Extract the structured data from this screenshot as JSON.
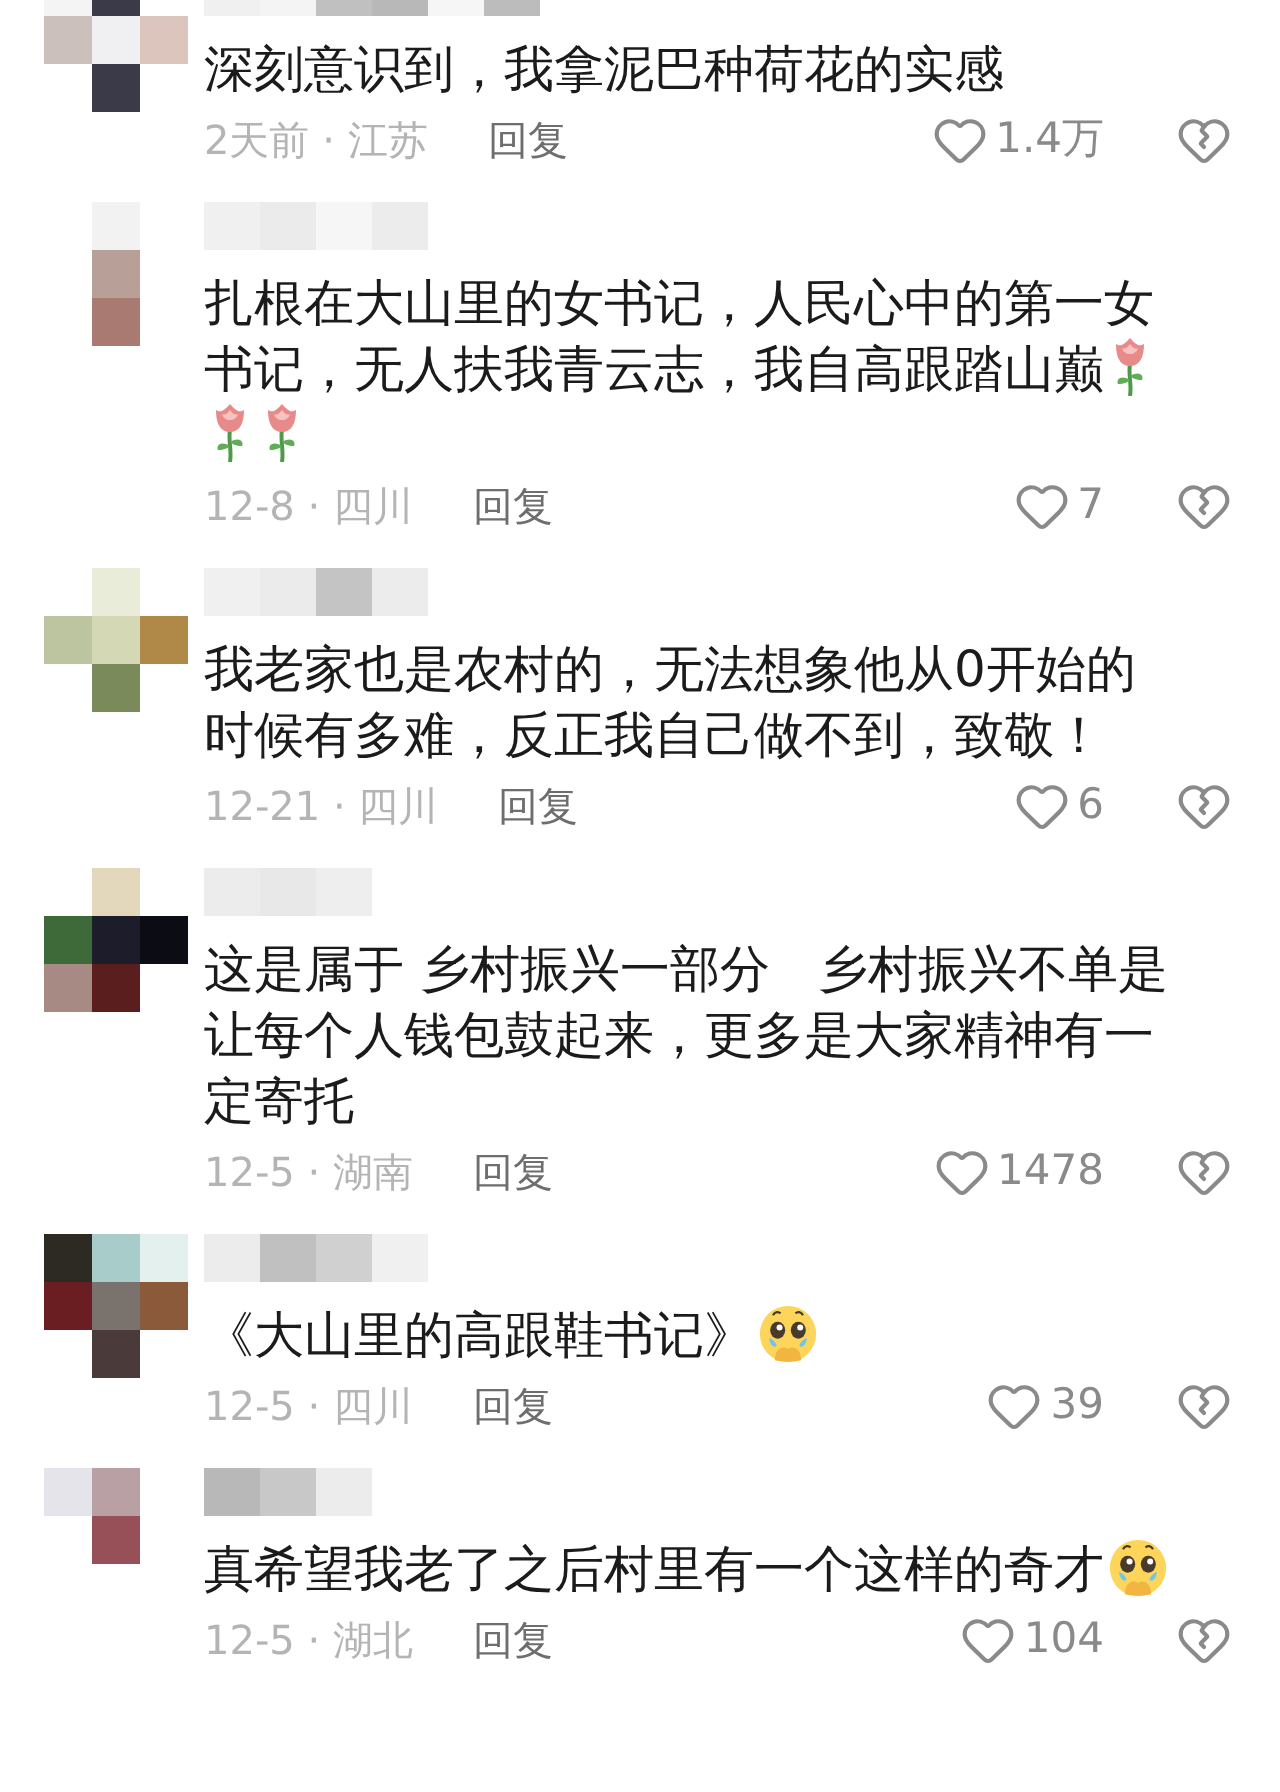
{
  "comments": [
    {
      "body": [
        {
          "kind": "text",
          "text": "深刻意识到，我拿泥巴种荷花的实感"
        }
      ],
      "time": "2天前 · 江苏",
      "reply": "回复",
      "likes": "1.4万"
    },
    {
      "body": [
        {
          "kind": "text",
          "text": "扎根在大山里的女书记，人民心中的第一女书记，无人扶我青云志，我自高跟踏山巅"
        },
        {
          "kind": "rose"
        },
        {
          "kind": "rose"
        },
        {
          "kind": "rose"
        }
      ],
      "time": "12-8 · 四川",
      "reply": "回复",
      "likes": "7"
    },
    {
      "body": [
        {
          "kind": "text",
          "text": "我老家也是农村的，无法想象他从0开始的时候有多难，反正我自己做不到，致敬！"
        }
      ],
      "time": "12-21 · 四川",
      "reply": "回复",
      "likes": "6"
    },
    {
      "body": [
        {
          "kind": "text",
          "text": "这是属于 乡村振兴一部分   乡村振兴不单是让每个人钱包鼓起来，更多是大家精神有一定寄托"
        }
      ],
      "time": "12-5 · 湖南",
      "reply": "回复",
      "likes": "1478"
    },
    {
      "body": [
        {
          "kind": "text",
          "text": "《大山里的高跟鞋书记》"
        },
        {
          "kind": "teary"
        }
      ],
      "time": "12-5 · 四川",
      "reply": "回复",
      "likes": "39"
    },
    {
      "body": [
        {
          "kind": "text",
          "text": "真希望我老了之后村里有一个这样的奇才"
        },
        {
          "kind": "teary"
        }
      ],
      "time": "12-5 · 湖北",
      "reply": "回复",
      "likes": "104"
    }
  ]
}
